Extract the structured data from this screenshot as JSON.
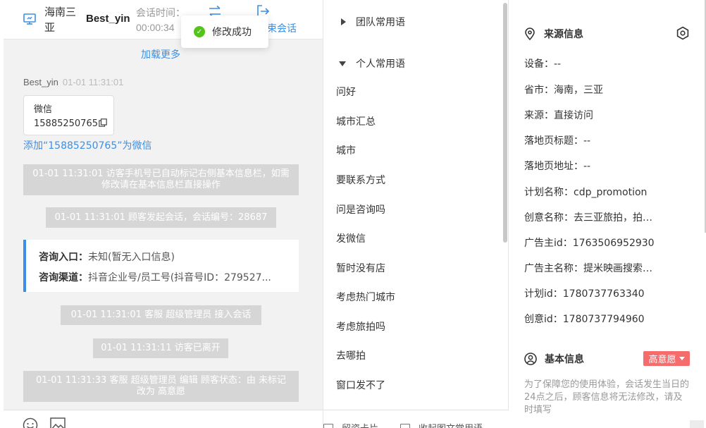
{
  "header": {
    "location": "海南三亚",
    "visitor_name": "Best_yin",
    "session_time_label": "会话时间：",
    "session_time": "00:00:34",
    "end_session_label": "结束会话",
    "end_session_partial": "束会话"
  },
  "toast": {
    "text": "修改成功",
    "color": "#52c41a"
  },
  "chat": {
    "load_more": "加载更多",
    "message": {
      "sender": "Best_yin",
      "time": "01-01 11:31:01",
      "card_title": "微信",
      "card_number": "15885250765"
    },
    "add_wechat_link": "添加“15885250765”为微信",
    "system_messages": [
      "01-01 11:31:01 访客手机号已自动标记右侧基本信息栏，如需修改请在基本信息栏直接操作",
      "01-01 11:31:01 顾客发起会话，会话编号：28687",
      "01-01 11:31:01 客服 超级管理员 接入会话",
      "01-01 11:31:11 访客已离开",
      "01-01 11:31:33 客服 超级管理员 编辑 顾客状态：由 未标记 改为 高意愿"
    ],
    "consult": {
      "entry_label": "咨询入口：",
      "entry_value": "未知(暂无入口信息)",
      "channel_label": "咨询渠道：",
      "channel_value": "抖音企业号/员工号(抖音号ID：279527..."
    }
  },
  "phrases": {
    "team_group": "团队常用语",
    "personal_group": "个人常用语",
    "items": [
      "问好",
      "城市汇总",
      "城市",
      "要联系方式",
      "问是咨询吗",
      "发微信",
      "暂时没有店",
      "考虑热门城市",
      "考虑旅拍吗",
      "去哪拍",
      "窗口发不了"
    ],
    "footer_buttons": [
      "留资卡片",
      "收起图文常用语"
    ]
  },
  "info": {
    "source_title": "来源信息",
    "rows": [
      "设备：--",
      "省市：海南，三亚",
      "来源：直接访问",
      "落地页标题：--",
      "落地页地址：--",
      "计划名称：cdp_promotion",
      "创意名称：去三亚旅拍，拍婚纱照",
      "广告主id：1763506952930",
      "广告主名称：提米映画搜索推广",
      "计划id：1780737763340",
      "创意id：1780737794960"
    ],
    "basic_title": "基本信息",
    "intent_badge": "高意愿",
    "note": "为了保障您的使用体验，会话发生当日的24点之后，顾客信息将无法修改，请及时填写",
    "accent_color": "#3b8fe6",
    "badge_color": "#f56c6c"
  }
}
